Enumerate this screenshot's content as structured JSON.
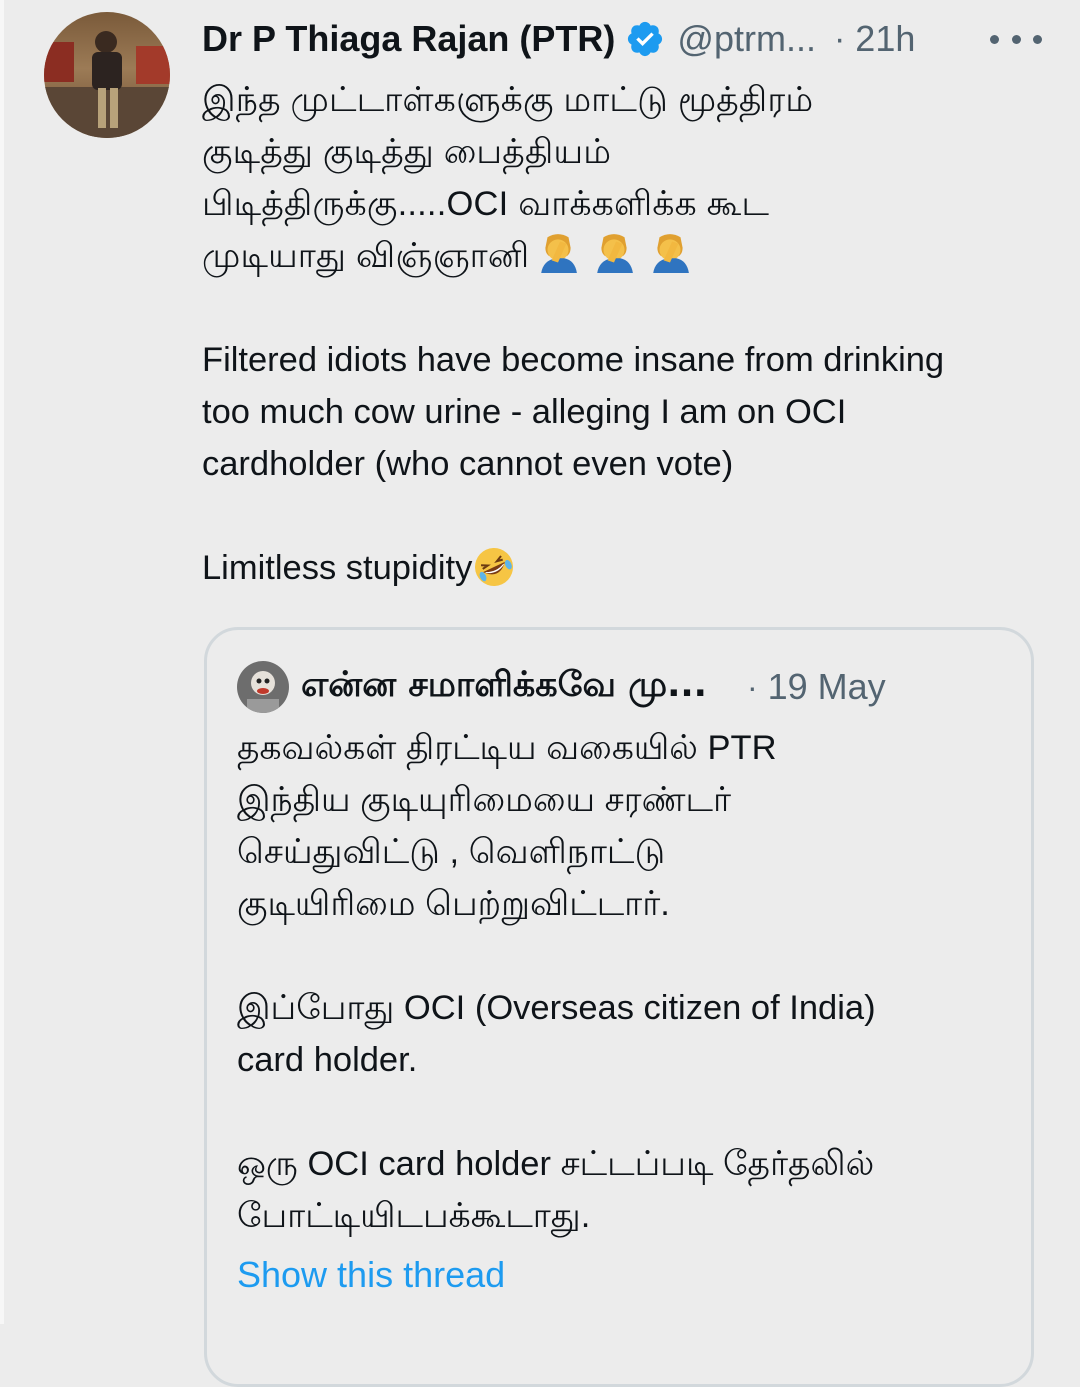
{
  "tweet": {
    "author_name": "Dr P Thiaga Rajan (PTR)",
    "handle": "@ptrm...",
    "separator": "·",
    "time": "21h",
    "tamil_lines": [
      "இந்த முட்டாள்களுக்கு மாட்டு மூத்திரம்",
      "குடித்து குடித்து பைத்தியம்",
      "பிடித்திருக்கு.....OCI வாக்களிக்க கூட",
      "முடியாது விஞ்ஞானி"
    ],
    "english_lines": [
      "Filtered idiots have become insane from drinking",
      "too much cow urine -  alleging I am on OCI",
      "cardholder (who cannot even vote)"
    ],
    "closing": "Limitless stupidity",
    "emojis": [
      "facepalm-emoji",
      "facepalm-emoji",
      "facepalm-emoji",
      "rolling-laughing-emoji"
    ]
  },
  "quoted": {
    "author_name": "என்ன சமாளிக்கவே மு...",
    "separator": "·",
    "time": "19 May",
    "para1": [
      "தகவல்கள் திரட்டிய வகையில் PTR",
      "இந்திய குடியுரிமையை சரண்டர்",
      "செய்துவிட்டு , வெளிநாட்டு",
      "குடியிரிமை பெற்றுவிட்டார்."
    ],
    "para2": [
      "இப்போது OCI (Overseas citizen of India)",
      "card holder."
    ],
    "para3": [
      "ஒரு OCI card holder சட்டப்படி தேர்தலில்",
      "போட்டியிடபக்கூடாது."
    ],
    "show_thread": "Show this thread"
  },
  "colors": {
    "background": "#ececec",
    "text": "#0f1419",
    "secondary": "#536471",
    "link": "#1d9bf0",
    "verified": "#1d9bf0",
    "border": "#d2d8dc"
  }
}
